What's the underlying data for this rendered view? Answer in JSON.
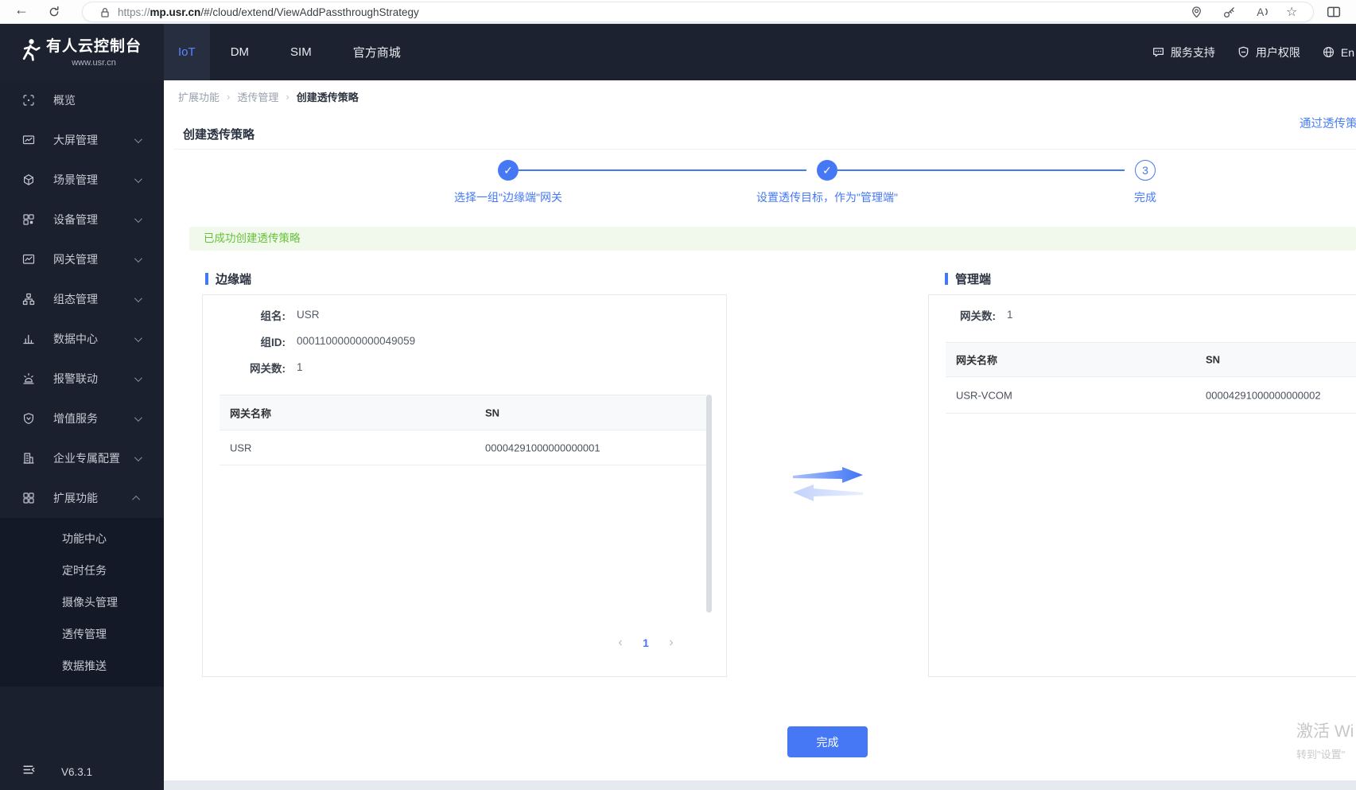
{
  "glyphs": {
    "back": "←",
    "star": "☆",
    "check": "✓",
    "prev": "‹",
    "next": "›",
    "crumb_sep": "›",
    "read_aloud": "A"
  },
  "browser": {
    "url_scheme": "https://",
    "url_host": "mp.usr.cn",
    "url_path": "/#/cloud/extend/ViewAddPassthroughStrategy"
  },
  "navbar": {
    "logo_title": "有人云控制台",
    "logo_subtitle": "www.usr.cn",
    "tabs": [
      {
        "label": "IoT"
      },
      {
        "label": "DM"
      },
      {
        "label": "SIM"
      },
      {
        "label": "官方商城"
      }
    ],
    "support_label": "服务支持",
    "permission_label": "用户权限",
    "lang_label": "En"
  },
  "sidebar": {
    "items": [
      {
        "label": "概览"
      },
      {
        "label": "大屏管理"
      },
      {
        "label": "场景管理"
      },
      {
        "label": "设备管理"
      },
      {
        "label": "网关管理"
      },
      {
        "label": "组态管理"
      },
      {
        "label": "数据中心"
      },
      {
        "label": "报警联动"
      },
      {
        "label": "增值服务"
      },
      {
        "label": "企业专属配置"
      },
      {
        "label": "扩展功能"
      }
    ],
    "submenu": [
      {
        "label": "功能中心"
      },
      {
        "label": "定时任务"
      },
      {
        "label": "摄像头管理"
      },
      {
        "label": "透传管理"
      },
      {
        "label": "数据推送"
      }
    ],
    "version": "V6.3.1"
  },
  "breadcrumb": {
    "items": [
      {
        "label": "扩展功能"
      },
      {
        "label": "透传管理"
      },
      {
        "label": "创建透传策略"
      }
    ]
  },
  "page": {
    "title": "创建透传策略",
    "top_link": "通过透传策"
  },
  "steps": [
    {
      "label": "选择一组\"边缘端\"网关",
      "marker": "✓"
    },
    {
      "label": "设置透传目标，作为\"管理端\"",
      "marker": "✓"
    },
    {
      "label": "完成",
      "marker": "3"
    }
  ],
  "alert": {
    "message": "已成功创建透传策略"
  },
  "edge_panel": {
    "title": "边缘端",
    "fields": [
      {
        "label": "组名:",
        "value": "USR"
      },
      {
        "label": "组ID:",
        "value": "00011000000000049059"
      },
      {
        "label": "网关数:",
        "value": "1"
      }
    ],
    "table": {
      "columns": [
        "网关名称",
        "SN"
      ],
      "rows": [
        [
          "USR",
          "00004291000000000001"
        ]
      ]
    },
    "pagination": {
      "current": "1"
    }
  },
  "manage_panel": {
    "title": "管理端",
    "fields": [
      {
        "label": "网关数:",
        "value": "1"
      }
    ],
    "table": {
      "columns": [
        "网关名称",
        "SN"
      ],
      "rows": [
        [
          "USR-VCOM",
          "00004291000000000002"
        ]
      ]
    }
  },
  "footer": {
    "finish_button": "完成"
  },
  "watermark": {
    "line1": "激活 Wi",
    "line2": "转到\"设置\""
  }
}
